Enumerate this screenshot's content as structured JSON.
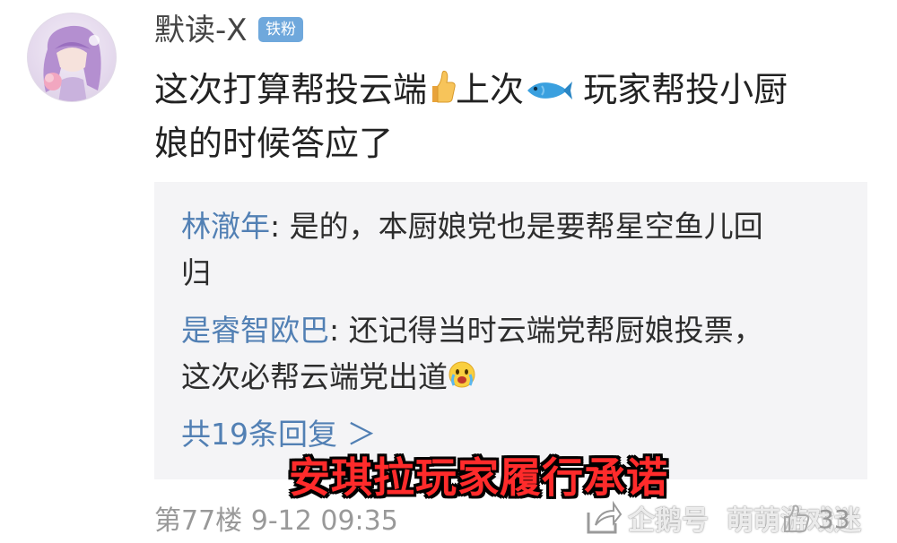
{
  "post": {
    "username": "默读-X",
    "badge": "铁粉",
    "content_part1": "这次打算帮投云端",
    "content_part2": "上次",
    "content_part3": " 玩家帮投小厨",
    "content_line2": "娘的时候答应了",
    "floor": "第77楼",
    "time": "9-12 09:35",
    "like_count": "33"
  },
  "replies": [
    {
      "user": "林澈年",
      "sep": ": ",
      "text_line1": "是的，本厨娘党也是要帮星空鱼儿回",
      "text_line2": "归"
    },
    {
      "user": "是睿智欧巴",
      "sep": ": ",
      "text_line1": "还记得当时云端党帮厨娘投票，",
      "text_line2": "这次必帮云端党出道"
    }
  ],
  "more_replies": "共19条回复 ＞",
  "overlay_caption": "安琪拉玩家履行承诺",
  "watermark": {
    "platform": "企鹅号",
    "account": "萌萌游戏迷"
  },
  "icons": {
    "thumbs_up": "thumbs-up-emoji",
    "fish": "fish-emoji",
    "crying": "crying-emoji",
    "share": "share-icon",
    "like": "like-icon"
  },
  "colors": {
    "badge": "#6fa8dc",
    "reply_user": "#5280b4",
    "reply_bg": "#f4f4f6",
    "overlay_text": "#ff2b2b",
    "meta": "#999999"
  }
}
